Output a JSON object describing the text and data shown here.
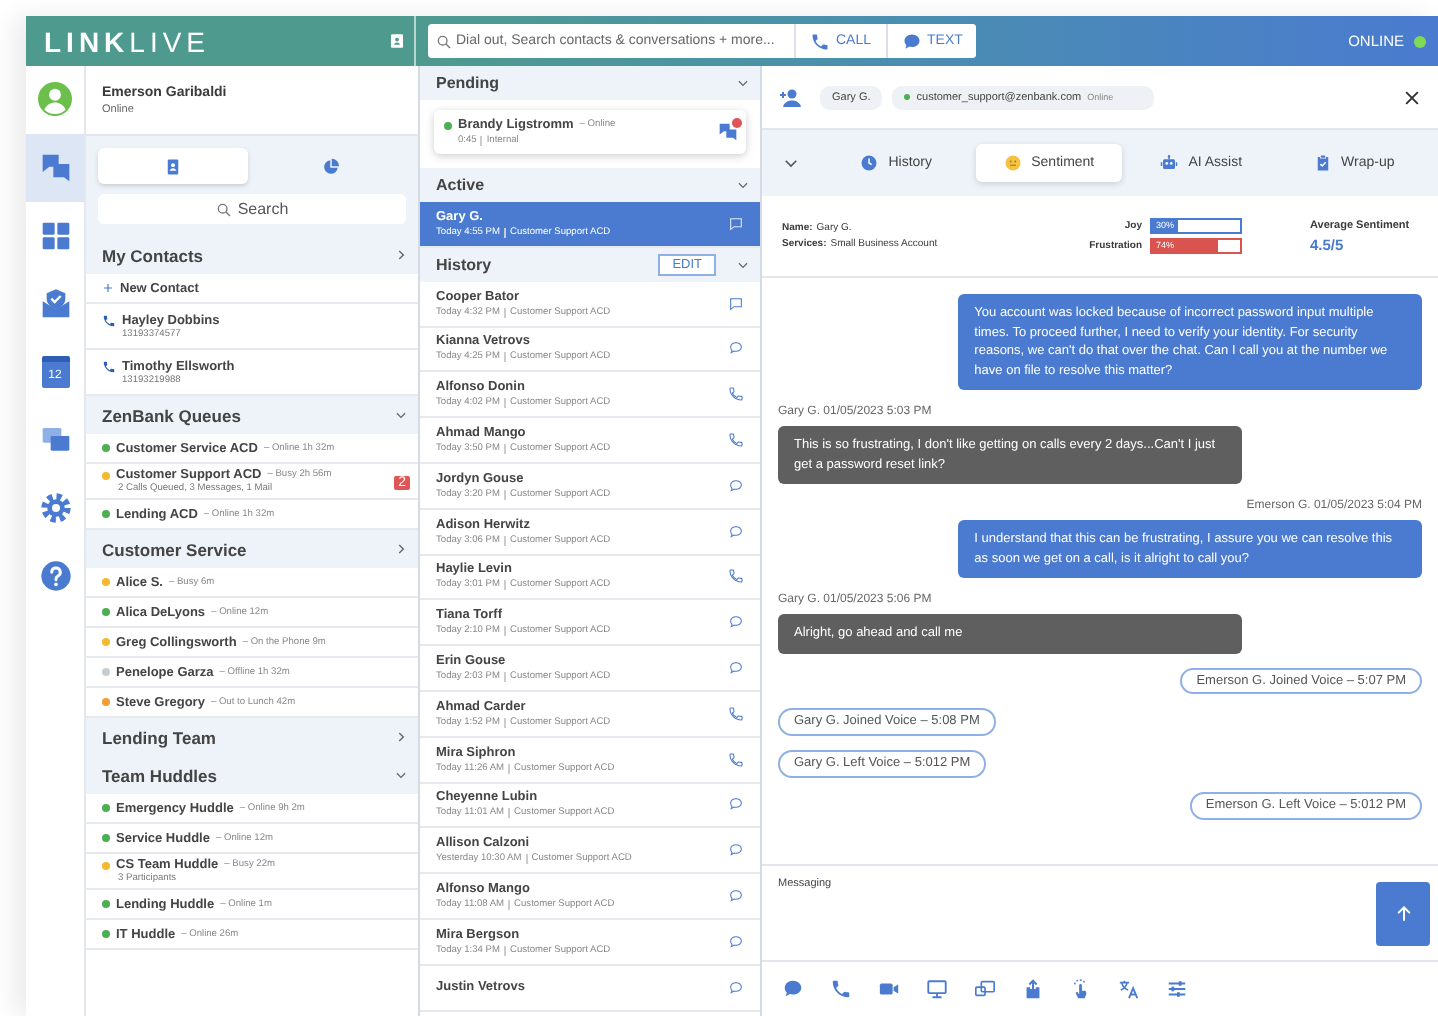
{
  "app": {
    "logo": "**LINK**LIVE",
    "status": "ONLINE",
    "online": true
  },
  "search": {
    "placeholder": "Dial out, Search contacts & conversations + more..."
  },
  "actions": [
    {
      "label": "CALL",
      "kind": "phone"
    },
    {
      "label": "TEXT",
      "kind": "bubble"
    }
  ],
  "rail": [
    {
      "kind": "chat",
      "selected": true
    },
    {
      "kind": "grid",
      "selected": false
    },
    {
      "kind": "mail",
      "selected": false
    },
    {
      "kind": "calendar",
      "selected": false,
      "day": "12"
    },
    {
      "kind": "screens",
      "selected": false
    },
    {
      "kind": "gear",
      "selected": false
    },
    {
      "kind": "help",
      "selected": false
    }
  ],
  "user": {
    "name": "Emerson Garibaldi",
    "status": "Online"
  },
  "panel_tabs": [
    {
      "kind": "contacts",
      "selected": true
    },
    {
      "kind": "pie",
      "selected": false
    }
  ],
  "panel_search": "Search",
  "groups": [
    {
      "title": "My Contacts",
      "expanded": false,
      "items": [
        {
          "kind": "action",
          "name": "New Contact"
        },
        {
          "kind": "contact",
          "name": "Hayley Dobbins",
          "detail": "13193374577"
        },
        {
          "kind": "contact",
          "name": "Timothy Ellsworth",
          "detail": "13193219988"
        }
      ]
    },
    {
      "title": "ZenBank Queues",
      "expanded": true,
      "items": [
        {
          "kind": "presence",
          "name": "Customer Service ACD",
          "status": "– Online  1h 32m",
          "color": "#4caf50"
        },
        {
          "kind": "presence",
          "name": "Customer Support ACD",
          "status": "– Busy 2h 56m",
          "detail": "2 Calls Queued, 3 Messages, 1 Mail",
          "badge": "2",
          "color": "#f5b82e"
        },
        {
          "kind": "presence",
          "name": "Lending ACD",
          "status": "– Online  1h 32m",
          "color": "#4caf50"
        }
      ]
    },
    {
      "title": "Customer Service",
      "expanded": false,
      "items": [
        {
          "kind": "presence",
          "name": "Alice S.",
          "status": "– Busy  6m",
          "color": "#f5b82e"
        },
        {
          "kind": "presence",
          "name": "Alica DeLyons",
          "status": "– Online  12m",
          "color": "#4caf50"
        },
        {
          "kind": "presence",
          "name": "Greg Collingsworth",
          "status": "– On the Phone  9m",
          "color": "#f5b82e"
        },
        {
          "kind": "presence",
          "name": "Penelope Garza",
          "status": "– Offline  1h 32m",
          "color": "#c8cdd3"
        },
        {
          "kind": "presence",
          "name": "Steve Gregory",
          "status": "– Out to Lunch  42m",
          "color": "#f39c34"
        }
      ]
    },
    {
      "title": "Lending Team",
      "expanded": false
    },
    {
      "title": "Team Huddles",
      "expanded": true,
      "items": [
        {
          "kind": "presence",
          "name": "Emergency Huddle",
          "status": "– Online  9h 2m",
          "color": "#4caf50"
        },
        {
          "kind": "presence",
          "name": "Service Huddle",
          "status": "– Online  12m",
          "color": "#4caf50"
        },
        {
          "kind": "presence",
          "name": "CS Team Huddle",
          "status": "– Busy  22m",
          "detail": "3 Participants",
          "color": "#f5b82e"
        },
        {
          "kind": "presence",
          "name": "Lending Huddle",
          "status": "– Online  1m",
          "color": "#4caf50"
        },
        {
          "kind": "presence",
          "name": "IT Huddle",
          "status": "– Online  26m",
          "color": "#4caf50"
        }
      ]
    }
  ],
  "queues": [
    {
      "title": "Pending",
      "kind": "pending",
      "expanded": true,
      "items": [
        {
          "name": "Brandy Ligstromm",
          "status": "– Online",
          "time": "0:45",
          "queue": "Internal",
          "color": "#4caf50",
          "unread": true
        }
      ]
    },
    {
      "title": "Active",
      "kind": "list",
      "expanded": true,
      "items": [
        {
          "name": "Gary G.",
          "time": "Today 4:55 PM",
          "queue": "Customer Support ACD",
          "kind": "chat",
          "selected": true
        }
      ]
    },
    {
      "title": "History",
      "kind": "list",
      "expanded": true,
      "action": "EDIT",
      "items": [
        {
          "name": "Cooper Bator",
          "time": "Today 4:32 PM",
          "queue": "Customer Support ACD",
          "kind": "chat",
          "selected": false
        },
        {
          "name": "Kianna Vetrovs",
          "time": "Today 4:25 PM",
          "queue": "Customer Support ACD",
          "kind": "message",
          "selected": false
        },
        {
          "name": "Alfonso Donin",
          "time": "Today 4:02 PM",
          "queue": "Customer Support ACD",
          "kind": "call",
          "selected": false
        },
        {
          "name": "Ahmad Mango",
          "time": "Today 3:50 PM",
          "queue": "Customer Support ACD",
          "kind": "call",
          "selected": false
        },
        {
          "name": "Jordyn Gouse",
          "time": "Today 3:20 PM",
          "queue": "Customer Support ACD",
          "kind": "message",
          "selected": false
        },
        {
          "name": "Adison Herwitz",
          "time": "Today 3:06 PM",
          "queue": "Customer Support ACD",
          "kind": "message",
          "selected": false
        },
        {
          "name": "Haylie Levin",
          "time": "Today 3:01 PM",
          "queue": "Customer Support ACD",
          "kind": "call",
          "selected": false
        },
        {
          "name": "Tiana Torff",
          "time": "Today 2:10 PM",
          "queue": "Customer Support ACD",
          "kind": "message",
          "selected": false
        },
        {
          "name": "Erin Gouse",
          "time": "Today 2:03 PM",
          "queue": "Customer Support ACD",
          "kind": "message",
          "selected": false
        },
        {
          "name": "Ahmad Carder",
          "time": "Today 1:52 PM",
          "queue": "Customer Support ACD",
          "kind": "call",
          "selected": false
        },
        {
          "name": "Mira Siphron",
          "time": "Today 11:26 AM",
          "queue": "Customer Support ACD",
          "kind": "call",
          "selected": false
        },
        {
          "name": "Cheyenne Lubin",
          "time": "Today 11:01 AM",
          "queue": "Customer Support ACD",
          "kind": "message",
          "selected": false
        },
        {
          "name": "Allison Calzoni",
          "time": "Yesterday 10:30 AM",
          "queue": "Customer Support ACD",
          "kind": "message",
          "selected": false
        },
        {
          "name": "Alfonso Mango",
          "time": "Today 11:08 AM",
          "queue": "Customer Support ACD",
          "kind": "message",
          "selected": false
        },
        {
          "name": "Mira Bergson",
          "time": "Today 1:34 PM",
          "queue": "Customer Support ACD",
          "kind": "message",
          "selected": false
        },
        {
          "name": "Justin Vetrovs",
          "kind": "message",
          "selected": false
        }
      ]
    }
  ],
  "conversation": {
    "contact": "Gary G.",
    "address": "customer_support@zenbank.com",
    "presence": "Online",
    "online": true,
    "tabs": [
      {
        "label": "History",
        "kind": "clock",
        "selected": false
      },
      {
        "label": "Sentiment",
        "kind": "smiley",
        "selected": true
      },
      {
        "label": "AI Assist",
        "kind": "robot",
        "selected": false
      },
      {
        "label": "Wrap-up",
        "kind": "clipboard",
        "selected": false
      }
    ],
    "sentiment": {
      "fields": [
        {
          "label": "Name:",
          "value": "Gary G."
        },
        {
          "label": "Services:",
          "value": "Small Business Account"
        }
      ],
      "meters": [
        {
          "label": "Joy",
          "reading": "30%",
          "level": 0.3,
          "color": "#4a7bd0"
        },
        {
          "label": "Frustration",
          "reading": "74%",
          "level": 0.74,
          "color": "#d9534f"
        }
      ],
      "average_label": "Average Sentiment",
      "average": "4.5/5"
    },
    "messages": [
      {
        "kind": "agent",
        "text": "You account was locked because of incorrect password input multiple times. To proceed further, I need to verify your identity. For security reasons, we can't do that over the chat. Can I call you at the number we have on file to resolve this matter?"
      },
      {
        "kind": "customer",
        "meta": "Gary G. 01/05/2023 5:03 PM",
        "text": "This is so frustrating, I don't like getting on calls every 2 days...Can't I just get a password reset link?"
      },
      {
        "kind": "agent",
        "meta": "Emerson G. 01/05/2023 5:04 PM",
        "text": "I understand that this can be frustrating, I assure you we can resolve this as soon we get on a call, is it alright to call you?"
      },
      {
        "kind": "customer",
        "meta": "Gary G. 01/05/2023 5:06 PM",
        "text": "Alright, go ahead and call me"
      },
      {
        "kind": "event",
        "outgoing": true,
        "text": "Emerson G. Joined Voice – 5:07 PM"
      },
      {
        "kind": "event",
        "outgoing": false,
        "text": "Gary G. Joined Voice – 5:08 PM"
      },
      {
        "kind": "event",
        "outgoing": false,
        "text": "Gary G. Left Voice – 5:012 PM"
      },
      {
        "kind": "event",
        "outgoing": true,
        "text": "Emerson G. Left Voice – 5:012 PM"
      }
    ],
    "composer": {
      "placeholder": "Messaging"
    },
    "tools": [
      {
        "kind": "chat"
      },
      {
        "kind": "phone"
      },
      {
        "kind": "video"
      },
      {
        "kind": "monitor"
      },
      {
        "kind": "screens"
      },
      {
        "kind": "upload"
      },
      {
        "kind": "gesture"
      },
      {
        "kind": "translate"
      },
      {
        "kind": "sliders"
      }
    ]
  }
}
